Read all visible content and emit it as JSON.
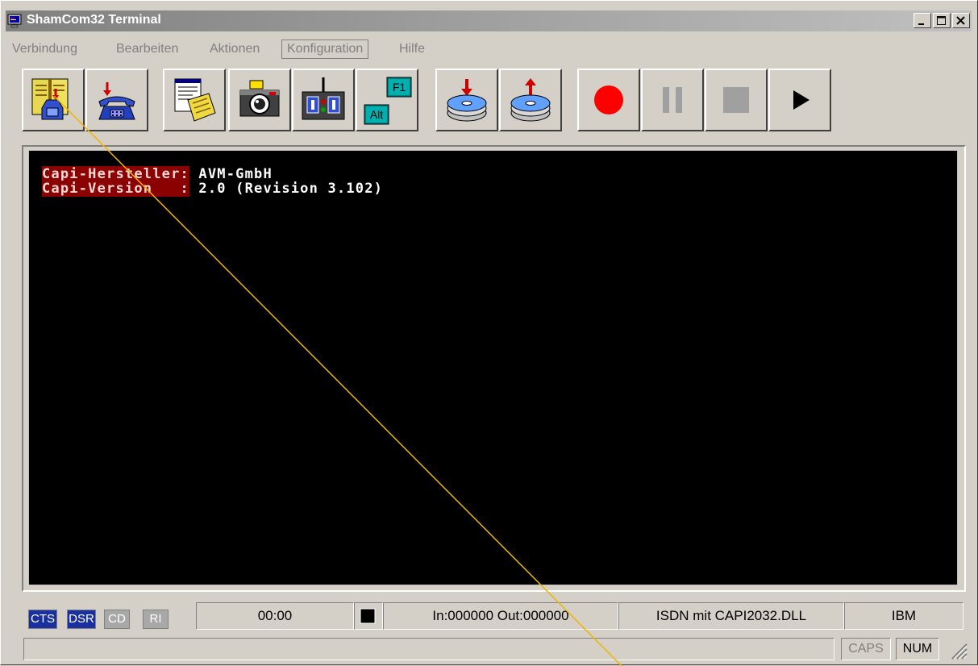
{
  "window": {
    "title": "ShamCom32 Terminal",
    "icon": "terminal-app-icon",
    "controls": [
      "minimize-icon",
      "maximize-icon",
      "close-icon"
    ]
  },
  "menu": {
    "items": [
      "Verbindung",
      "Bearbeiten",
      "Aktionen",
      "Konfiguration",
      "Hilfe"
    ],
    "active": "Konfiguration"
  },
  "toolbar": {
    "buttons": [
      {
        "name": "phonebook-dial-button",
        "icon": "phonebook-icon"
      },
      {
        "name": "hangup-button",
        "icon": "telephone-icon"
      },
      {
        "name": "file-transfer-button",
        "icon": "document-icon"
      },
      {
        "name": "screenshot-button",
        "icon": "camera-icon"
      },
      {
        "name": "remote-control-button",
        "icon": "joystick-icon"
      },
      {
        "name": "function-keys-button",
        "icon": "function-keys-icon",
        "labels": [
          "F1",
          "Alt"
        ]
      },
      {
        "name": "download-button",
        "icon": "disk-download-icon"
      },
      {
        "name": "upload-button",
        "icon": "disk-upload-icon"
      },
      {
        "name": "record-button",
        "icon": "record-icon"
      },
      {
        "name": "pause-button",
        "icon": "pause-icon"
      },
      {
        "name": "stop-button",
        "icon": "stop-icon"
      },
      {
        "name": "play-button",
        "icon": "play-icon"
      }
    ]
  },
  "terminal": {
    "lines": [
      {
        "label": "Capi-Hersteller:",
        "value": " AVM-GmbH"
      },
      {
        "label": "Capi-Version   :",
        "value": " 2.0 (Revision 3.102)"
      }
    ],
    "colors": {
      "background": "#000000",
      "label_bg": "#8b0000",
      "text": "#ffffff"
    }
  },
  "status": {
    "leds": [
      {
        "label": "CTS",
        "state": "on"
      },
      {
        "label": "DSR",
        "state": "on"
      },
      {
        "label": "CD",
        "state": "off"
      },
      {
        "label": "RI",
        "state": "off"
      }
    ],
    "timer": "00:00",
    "counters": "In:000000 Out:000000",
    "device": "ISDN mit CAPI2032.DLL",
    "emulation": "IBM",
    "caps": "CAPS",
    "num": "NUM"
  }
}
